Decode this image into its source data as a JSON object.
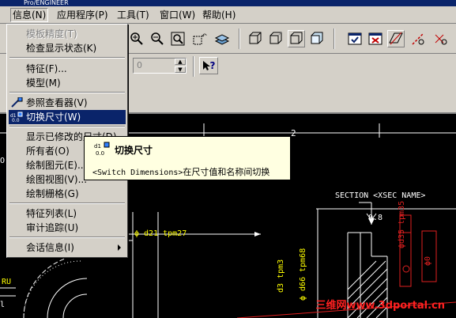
{
  "window": {
    "title": "Pro/ENGINEER"
  },
  "menubar": {
    "items": [
      {
        "label": "信息(N)",
        "active": true
      },
      {
        "label": "应用程序(P)"
      },
      {
        "label": "工具(T)"
      },
      {
        "label": "窗口(W)"
      },
      {
        "label": "帮助(H)"
      }
    ]
  },
  "toolbar": {
    "spin_value": "0",
    "help_label": "?"
  },
  "info_menu": {
    "items": [
      {
        "label": "模板精度(T)",
        "disabled": true
      },
      {
        "label": "检查显示状态(K)"
      },
      {
        "label": "特征(F)..."
      },
      {
        "label": "模型(M)"
      },
      {
        "label": "参照查看器(V)"
      },
      {
        "label": "切换尺寸(W)",
        "highlighted": true
      },
      {
        "label": "显示已修改的尺寸(D)"
      },
      {
        "label": "所有者(O)"
      },
      {
        "label": "绘制图元(E)..."
      },
      {
        "label": "绘图视图(V)..."
      },
      {
        "label": "绘制栅格(G)"
      },
      {
        "label": "特征列表(L)"
      },
      {
        "label": "审计追踪(U)"
      },
      {
        "label": "会话信息(I)",
        "submenu": true
      }
    ]
  },
  "tooltip": {
    "title": "切换尺寸",
    "desc_en": "<Switch Dimensions>",
    "desc_cn": "在尺寸值和名称间切换",
    "icon_text": "d1"
  },
  "drawing": {
    "zone_number": "2",
    "section_label": "SECTION <XSEC NAME>",
    "dim_08": "0.8",
    "dim_d21": "ϕ d21 tpm27",
    "dim_phi": "ϕ1",
    "dim_d35": "ϕd35 tpm35",
    "dim_d66": "ϕ d66 tpm68",
    "dim_d3": "d3 tpm3",
    "ru": "RU",
    "l": "l",
    "co": "O",
    "tolerance_box": "ϕ0",
    "marker_4": "4"
  },
  "watermark": "三维网www.3dportal.cn",
  "colors": {
    "menu_bg": "#d4d0c8",
    "highlight": "#0a246a",
    "tooltip_bg": "#ffffe1",
    "canvas_bg": "#000000",
    "drawing_line": "#ffffff",
    "dim_color": "#ffff00",
    "watermark": "#ff2020",
    "accent_red": "#e02020"
  }
}
